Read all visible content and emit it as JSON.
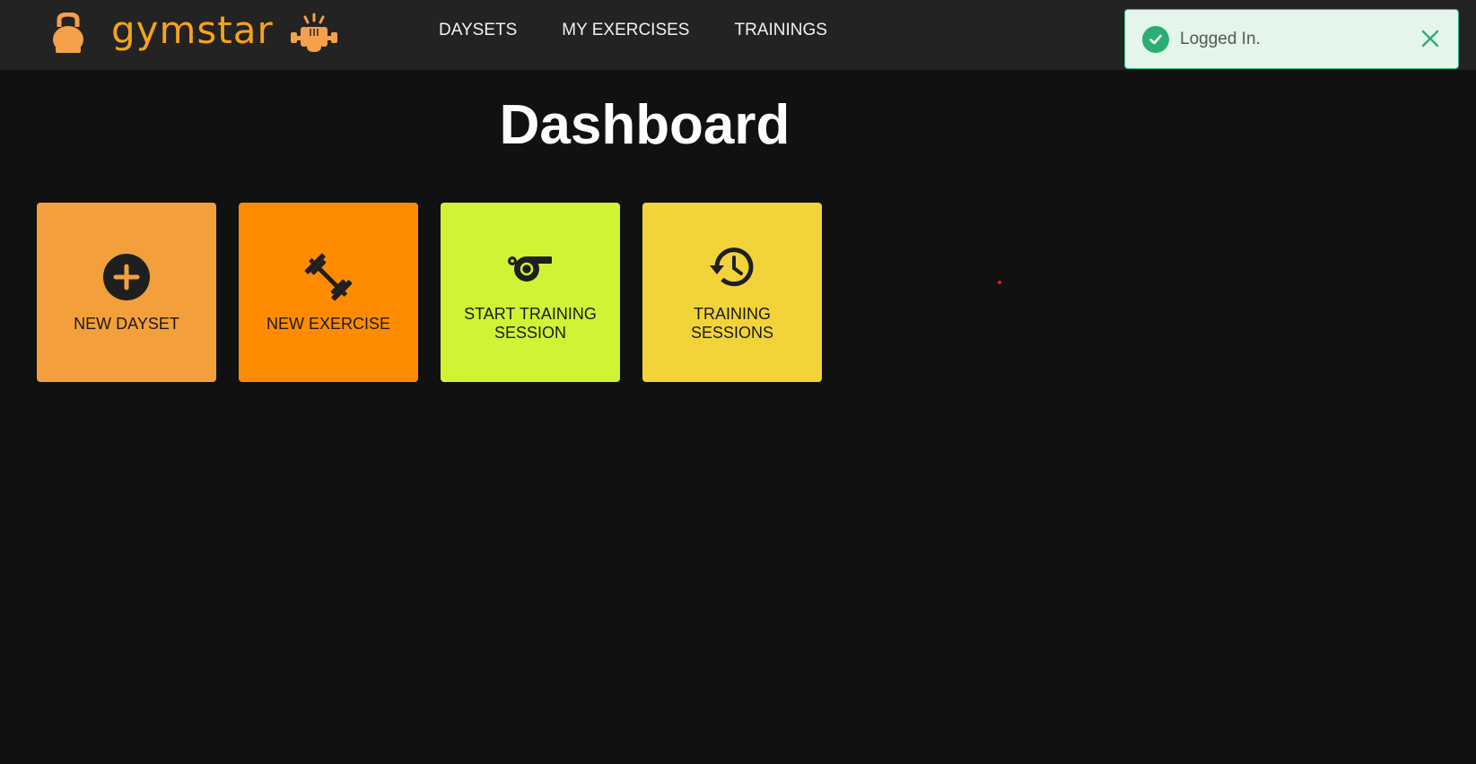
{
  "brand": {
    "name": "gymstar",
    "color": "#f5a31a"
  },
  "nav": {
    "links": [
      {
        "label": "DAYSETS"
      },
      {
        "label": "MY EXERCISES"
      },
      {
        "label": "TRAININGS"
      }
    ]
  },
  "toast": {
    "message": "Logged In.",
    "status": "success",
    "icon": "check-circle-icon",
    "close_icon": "close-icon"
  },
  "main": {
    "title": "Dashboard",
    "tiles": [
      {
        "label": "NEW DAYSET",
        "icon": "plus-circle-icon",
        "color": "#f3a03c"
      },
      {
        "label": "NEW EXERCISE",
        "icon": "dumbbell-icon",
        "color": "#ff8c00"
      },
      {
        "label": "START TRAINING SESSION",
        "icon": "whistle-icon",
        "color": "#d0f335"
      },
      {
        "label": "TRAINING SESSIONS",
        "icon": "history-icon",
        "color": "#f2d43a"
      }
    ]
  }
}
